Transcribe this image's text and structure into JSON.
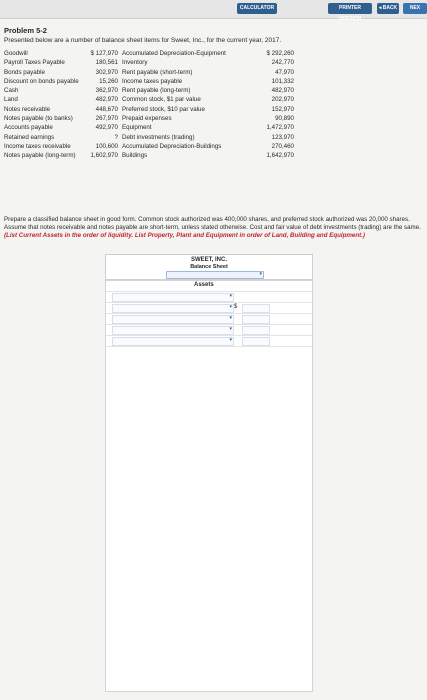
{
  "toolbar": {
    "calculator": "CALCULATOR",
    "printer_version": "PRINTER VERSION",
    "back": "◂ BACK",
    "next": "NEX"
  },
  "problem": {
    "title": "Problem 5-2",
    "intro": "Presented below are a number of balance sheet items for Sweet, Inc., for the current year, 2017."
  },
  "items": [
    {
      "lname": "Goodwill",
      "lval": "$ 127,970",
      "rname": "Accumulated Depreciation-Equipment",
      "rval": "$ 292,260"
    },
    {
      "lname": "Payroll Taxes Payable",
      "lval": "180,561",
      "rname": "Inventory",
      "rval": "242,770"
    },
    {
      "lname": "Bonds payable",
      "lval": "302,970",
      "rname": "Rent payable (short-term)",
      "rval": "47,970"
    },
    {
      "lname": "Discount on bonds payable",
      "lval": "15,260",
      "rname": "Income taxes payable",
      "rval": "101,332"
    },
    {
      "lname": "Cash",
      "lval": "362,970",
      "rname": "Rent payable (long-term)",
      "rval": "482,970"
    },
    {
      "lname": "Land",
      "lval": "482,970",
      "rname": "Common stock, $1 par value",
      "rval": "202,970"
    },
    {
      "lname": "Notes receivable",
      "lval": "448,670",
      "rname": "Preferred stock, $10 par value",
      "rval": "152,970"
    },
    {
      "lname": "Notes payable (to banks)",
      "lval": "267,970",
      "rname": "Prepaid expenses",
      "rval": "90,890"
    },
    {
      "lname": "Accounts payable",
      "lval": "492,970",
      "rname": "Equipment",
      "rval": "1,472,970"
    },
    {
      "lname": "Retained earnings",
      "lval": "?",
      "rname": "Debt investments (trading)",
      "rval": "123,970"
    },
    {
      "lname": "Income taxes receivable",
      "lval": "100,600",
      "rname": "Accumulated Depreciation-Buildings",
      "rval": "270,460"
    },
    {
      "lname": "Notes payable (long-term)",
      "lval": "1,602,970",
      "rname": "Buildings",
      "rval": "1,642,970"
    }
  ],
  "instructions": {
    "text": "Prepare a classified balance sheet in good form. Common stock authorized was 400,000 shares, and preferred stock authorized was 20,000 shares. Assume that notes receivable and notes payable are short-term, unless stated otherwise. Cost and fair value of debt investments (trading) are the same. ",
    "emphasis": "(List Current Assets in the order of liquidity. List Property, Plant and Equipment in order of Land, Building and Equipment.)"
  },
  "balance_sheet": {
    "company": "SWEET, INC.",
    "statement": "Balance Sheet",
    "assets_header": "Assets",
    "currency_symbol": "$"
  }
}
